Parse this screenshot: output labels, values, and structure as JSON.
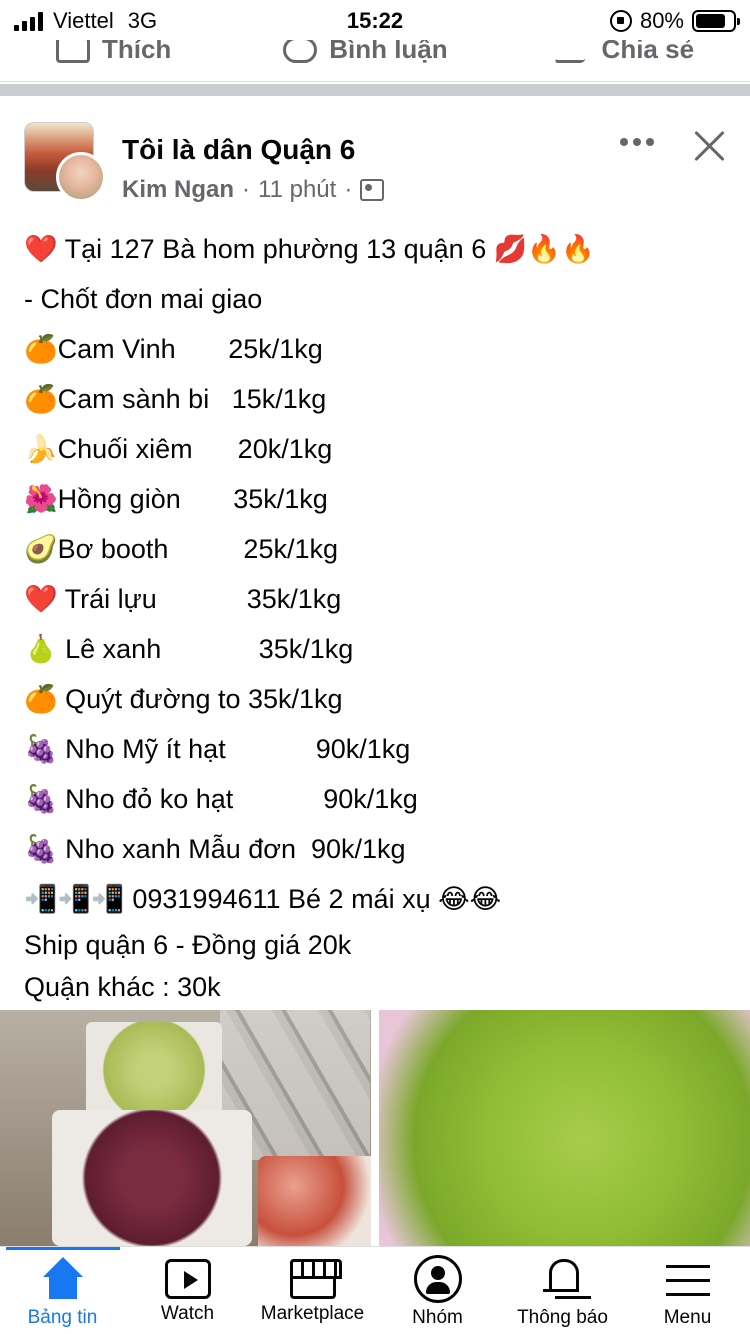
{
  "status_bar": {
    "carrier": "Viettel",
    "network": "3G",
    "time": "15:22",
    "battery": "80%",
    "battery_level": 0.8
  },
  "prev_post_actions": {
    "like": "Thích",
    "comment": "Bình luận",
    "share": "Chia sẻ"
  },
  "post": {
    "group_name": "Tôi là dân Quận 6",
    "author": "Kim Ngan",
    "separator": "·",
    "time_ago": "11 phút",
    "lines": [
      {
        "emoji": "❤️",
        "text": " Tại 127 Bà hom phường 13 quận 6 ",
        "suffix": "💋🔥🔥"
      },
      {
        "emoji": "",
        "text": "- Chốt đơn mai giao",
        "suffix": ""
      },
      {
        "emoji": "🍊",
        "text": "Cam Vinh       25k/1kg",
        "suffix": ""
      },
      {
        "emoji": "🍊",
        "text": "Cam sành bi   15k/1kg",
        "suffix": ""
      },
      {
        "emoji": "🍌",
        "text": "Chuối xiêm      20k/1kg",
        "suffix": ""
      },
      {
        "emoji": "🌺",
        "text": "Hồng giòn       35k/1kg",
        "suffix": ""
      },
      {
        "emoji": "🥑",
        "text": "Bơ booth          25k/1kg",
        "suffix": ""
      },
      {
        "emoji": "❤️",
        "text": " Trái lựu            35k/1kg",
        "suffix": ""
      },
      {
        "emoji": "🍐",
        "text": " Lê xanh             35k/1kg",
        "suffix": ""
      },
      {
        "emoji": "🍊",
        "text": " Quýt đường to 35k/1kg",
        "suffix": ""
      },
      {
        "emoji": "🍇",
        "text": " Nho Mỹ ít hạt            90k/1kg",
        "suffix": ""
      },
      {
        "emoji": "🍇",
        "text": " Nho đỏ ko hạt            90k/1kg",
        "suffix": ""
      },
      {
        "emoji": "🍇",
        "text": " Nho xanh Mẫu đơn  90k/1kg",
        "suffix": ""
      },
      {
        "emoji": "📲📲📲",
        "text": " 0931994611 Bé 2 mái xụ ",
        "suffix": "😂😂"
      }
    ],
    "footer_lines": [
      "Ship quận 6 - Đồng giá 20k",
      "Quận khác : 30k"
    ]
  },
  "tab_bar": {
    "tabs": [
      {
        "label": "Bảng tin",
        "icon": "home-icon",
        "active": true
      },
      {
        "label": "Watch",
        "icon": "watch-icon",
        "active": false
      },
      {
        "label": "Marketplace",
        "icon": "marketplace-icon",
        "active": false
      },
      {
        "label": "Nhóm",
        "icon": "groups-icon",
        "active": false
      },
      {
        "label": "Thông báo",
        "icon": "bell-icon",
        "active": false
      },
      {
        "label": "Menu",
        "icon": "menu-icon",
        "active": false
      }
    ],
    "accent": "#1877f2"
  }
}
